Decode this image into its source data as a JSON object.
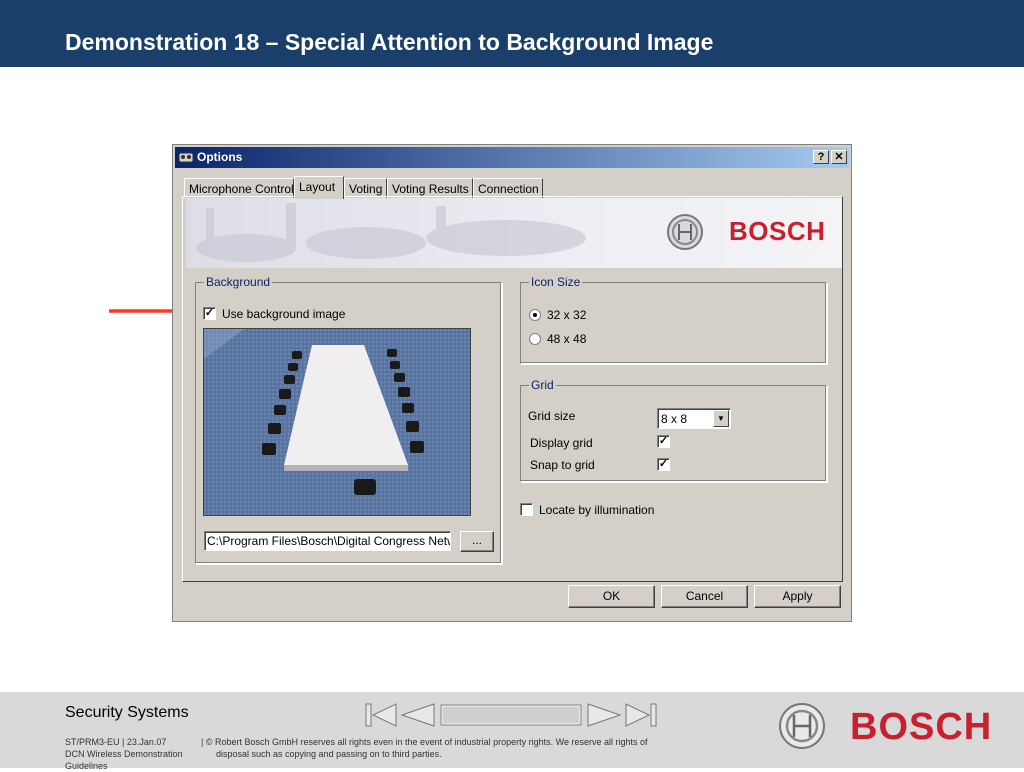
{
  "slide": {
    "title": "Demonstration 18 – Special Attention to Background Image"
  },
  "dialog": {
    "title": "Options",
    "help_btn": "?",
    "close_btn": "✕",
    "tabs": [
      {
        "label": "Microphone Control"
      },
      {
        "label": "Layout"
      },
      {
        "label": "Voting"
      },
      {
        "label": "Voting Results"
      },
      {
        "label": "Connection"
      }
    ],
    "active_tab": "Layout",
    "banner_brand": "BOSCH",
    "background": {
      "group_label": "Background",
      "use_bg_label": "Use background image",
      "use_bg_checked": true,
      "path_value": "C:\\Program Files\\Bosch\\Digital Congress Netwo",
      "browse_label": "..."
    },
    "icon_size": {
      "group_label": "Icon Size",
      "options": [
        "32 x 32",
        "48 x 48"
      ],
      "selected": "32 x 32"
    },
    "grid": {
      "group_label": "Grid",
      "size_label": "Grid size",
      "size_value": "8 x 8",
      "display_label": "Display grid",
      "display_checked": true,
      "snap_label": "Snap to grid",
      "snap_checked": true
    },
    "locate": {
      "label": "Locate by illumination",
      "checked": false
    },
    "buttons": {
      "ok": "OK",
      "cancel": "Cancel",
      "apply": "Apply"
    }
  },
  "footer": {
    "company": "Security Systems",
    "meta_line1": "ST/PRM3-EU  |  23.Jan.07",
    "meta_line2": "DCN Wireless Demonstration",
    "meta_line3": "Guidelines",
    "copyright_line1": "| © Robert Bosch GmbH reserves all rights even in the event of industrial property rights. We reserve all rights of",
    "copyright_line2": "disposal such as copying and passing on to third parties.",
    "brand": "BOSCH"
  },
  "colors": {
    "header_bg": "#1a3f6b",
    "brand_red": "#c8202f",
    "arrow": "#ff3b1f",
    "footer_bg": "#d9d9d9"
  }
}
